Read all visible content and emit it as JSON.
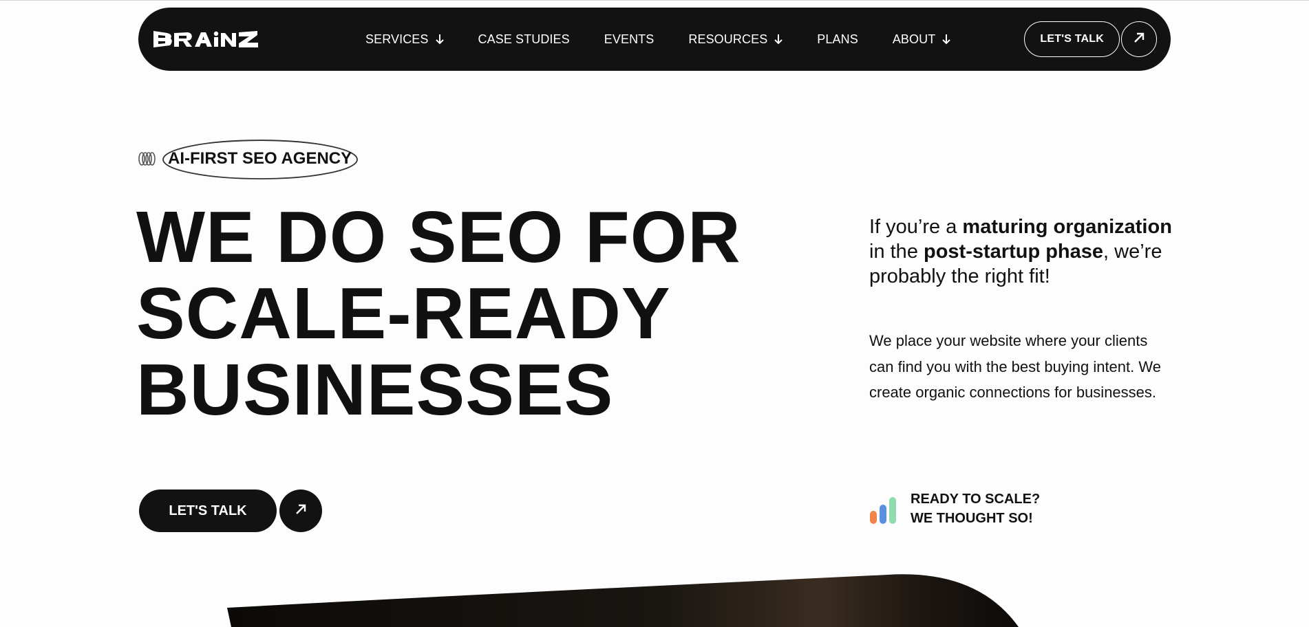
{
  "brand": {
    "logo_text": "BRAiNZ"
  },
  "nav": {
    "items": [
      {
        "label": "SERVICES",
        "has_dropdown": true
      },
      {
        "label": "CASE STUDIES",
        "has_dropdown": false
      },
      {
        "label": "EVENTS",
        "has_dropdown": false
      },
      {
        "label": "RESOURCES",
        "has_dropdown": true
      },
      {
        "label": "PLANS",
        "has_dropdown": false
      },
      {
        "label": "ABOUT",
        "has_dropdown": true
      }
    ],
    "cta_label": "LET'S TALK",
    "cta_icon": "arrow-up-right-icon"
  },
  "hero": {
    "badge": "AI-FIRST SEO AGENCY",
    "headline": [
      "WE DO SEO FOR",
      "SCALE-READY",
      "BUSINESSES"
    ],
    "intro": {
      "p1": "If you’re a ",
      "b1": "maturing organization",
      "p2": " in the ",
      "b2": "post-startup phase",
      "p3": ", we’re probably the right fit!"
    },
    "description": "We place your website where your clients can find you with the best buying intent. We create organic connections for businesses.",
    "cta_label": "LET'S TALK",
    "ready_line1": "READY TO SCALE?",
    "ready_line2": "WE THOUGHT SO!"
  },
  "colors": {
    "nav_bg": "#121212",
    "page_bg": "#fdfdfd",
    "bar_orange": "#f0844a",
    "bar_blue": "#5b8fe0",
    "bar_green": "#8fdcb0"
  }
}
